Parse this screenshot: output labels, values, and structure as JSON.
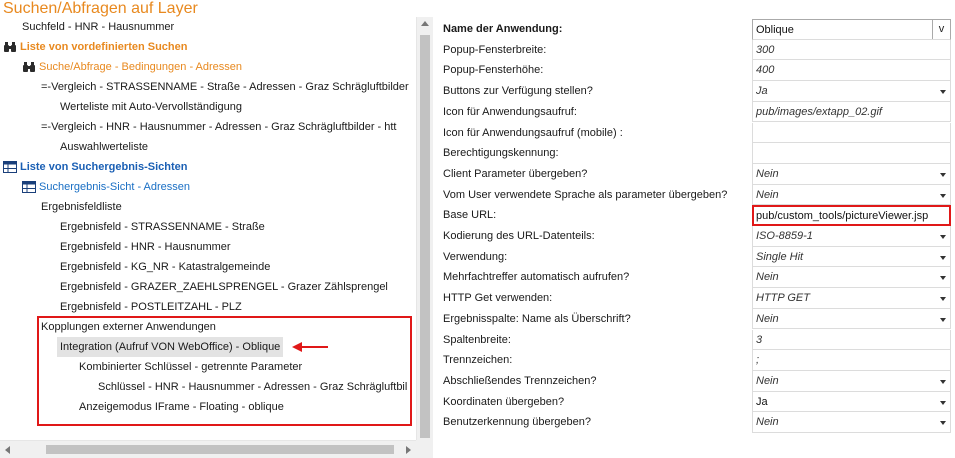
{
  "panel": {
    "title": "Suchen/Abfragen auf Layer"
  },
  "tree": {
    "items": [
      {
        "label": "Suchfeld - HNR - Hausnummer"
      },
      {
        "label": "Liste von vordefinierten Suchen",
        "icon": "binoculars-icon"
      },
      {
        "label": "Suche/Abfrage - Bedingungen - Adressen",
        "icon": "binoculars-icon"
      },
      {
        "label": "=-Vergleich - STRASSENNAME - Straße - Adressen - Graz Schrägluftbilder"
      },
      {
        "label": "Werteliste mit Auto-Vervollständigung"
      },
      {
        "label": "=-Vergleich - HNR - Hausnummer - Adressen - Graz Schrägluftbilder - htt"
      },
      {
        "label": "Auswahlwerteliste"
      },
      {
        "label": "Liste von Suchergebnis-Sichten",
        "icon": "table-icon"
      },
      {
        "label": "Suchergebnis-Sicht - Adressen",
        "icon": "table-icon"
      },
      {
        "label": "Ergebnisfeldliste"
      },
      {
        "label": "Ergebnisfeld - STRASSENNAME - Straße"
      },
      {
        "label": "Ergebnisfeld - HNR - Hausnummer"
      },
      {
        "label": "Ergebnisfeld - KG_NR - Katastralgemeinde"
      },
      {
        "label": "Ergebnisfeld - GRAZER_ZAEHLSPRENGEL - Grazer Zählsprengel"
      },
      {
        "label": "Ergebnisfeld - POSTLEITZAHL - PLZ"
      },
      {
        "label": "Kopplungen externer Anwendungen"
      },
      {
        "label": "Integration (Aufruf VON WebOffice) - Oblique"
      },
      {
        "label": "Kombinierter Schlüssel - getrennte Parameter"
      },
      {
        "label": "Schlüssel - HNR - Hausnummer - Adressen - Graz Schrägluftbil"
      },
      {
        "label": "Anzeigemodus IFrame - Floating - oblique"
      }
    ]
  },
  "properties": {
    "rows": [
      {
        "name": "Name der Anwendung:",
        "value": "Oblique",
        "control": "v-button"
      },
      {
        "name": "Popup-Fensterbreite:",
        "value": "300"
      },
      {
        "name": "Popup-Fensterhöhe:",
        "value": "400"
      },
      {
        "name": "Buttons zur Verfügung stellen?",
        "value": "Ja",
        "control": "dropdown"
      },
      {
        "name": "Icon für Anwendungsaufruf:",
        "value": "pub/images/extapp_02.gif"
      },
      {
        "name": "Icon für Anwendungsaufruf (mobile) :",
        "value": ""
      },
      {
        "name": "Berechtigungskennung:",
        "value": ""
      },
      {
        "name": "Client Parameter übergeben?",
        "value": "Nein",
        "control": "dropdown"
      },
      {
        "name": "Vom User verwendete Sprache als parameter übergeben?",
        "value": "Nein",
        "control": "dropdown"
      },
      {
        "name": "Base URL:",
        "value": "pub/custom_tools/pictureViewer.jsp",
        "highlighted": true
      },
      {
        "name": "Kodierung des URL-Datenteils:",
        "value": "ISO-8859-1",
        "control": "dropdown"
      },
      {
        "name": "Verwendung:",
        "value": "Single Hit",
        "control": "dropdown"
      },
      {
        "name": "Mehrfachtreffer automatisch aufrufen?",
        "value": "Nein",
        "control": "dropdown"
      },
      {
        "name": "HTTP Get verwenden:",
        "value": "HTTP GET",
        "control": "dropdown"
      },
      {
        "name": "Ergebnisspalte: Name als Überschrift?",
        "value": "Nein",
        "control": "dropdown"
      },
      {
        "name": "Spaltenbreite:",
        "value": "3"
      },
      {
        "name": "Trennzeichen:",
        "value": ";"
      },
      {
        "name": "Abschließendes Trennzeichen?",
        "value": "Nein",
        "control": "dropdown"
      },
      {
        "name": "Koordinaten übergeben?",
        "value": "Ja",
        "control": "dropdown"
      },
      {
        "name": "Benutzerkennung übergeben?",
        "value": "Nein",
        "control": "dropdown"
      }
    ]
  },
  "colors": {
    "title_orange": "#e8891f",
    "section_blue": "#1a5fb4",
    "annotation_red": "#e01818"
  }
}
